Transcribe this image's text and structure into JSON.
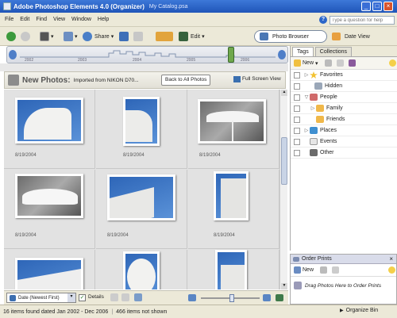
{
  "window": {
    "app_title": "Adobe Photoshop Elements 4.0 (Organizer)",
    "catalog": "My Catalog.psa",
    "minimize": "_",
    "maximize": "□",
    "close": "×"
  },
  "menu": [
    "File",
    "Edit",
    "Find",
    "View",
    "Window",
    "Help"
  ],
  "help_search": {
    "placeholder": "Type a question for help"
  },
  "toolbar": {
    "share_label": "Share",
    "edit_label": "Edit",
    "photo_browser_label": "Photo Browser",
    "date_view_label": "Date View"
  },
  "timeline": {
    "years": [
      "2002",
      "2003",
      "2004",
      "2005",
      "2006"
    ]
  },
  "new_photos": {
    "title": "New Photos:",
    "source": "Imported from NIKON D70...",
    "back_button": "Back to All Photos",
    "full_screen": "Full Screen View"
  },
  "photos": [
    {
      "date": "8/19/2004"
    },
    {
      "date": "8/19/2004"
    },
    {
      "date": "8/19/2004"
    },
    {
      "date": "8/19/2004"
    },
    {
      "date": "8/19/2004"
    },
    {
      "date": "8/19/2004"
    },
    {
      "date": ""
    },
    {
      "date": ""
    },
    {
      "date": ""
    }
  ],
  "bottom": {
    "sort": "Date (Newest First)",
    "details": "Details"
  },
  "status": {
    "text": "16 items found dated Jan 2002 - Dec 2006",
    "hidden": "466 items not shown",
    "organize_bin": "Organize Bin"
  },
  "panel": {
    "tabs": [
      "Tags",
      "Collections"
    ],
    "new_label": "New",
    "tags": [
      {
        "label": "Favorites",
        "level": 0,
        "expander": "▷",
        "icon": "star-icon"
      },
      {
        "label": "Hidden",
        "level": 1,
        "expander": "",
        "icon": "hidden-tag-icon"
      },
      {
        "label": "People",
        "level": 0,
        "expander": "▽",
        "icon": "people-icon"
      },
      {
        "label": "Family",
        "level": 1,
        "expander": "▷",
        "icon": "folder-icon"
      },
      {
        "label": "Friends",
        "level": 1,
        "expander": "",
        "icon": "folder-icon"
      },
      {
        "label": "Places",
        "level": 0,
        "expander": "▷",
        "icon": "globe-icon"
      },
      {
        "label": "Events",
        "level": 0,
        "expander": "",
        "icon": "calendar-icon"
      },
      {
        "label": "Other",
        "level": 0,
        "expander": "",
        "icon": "other-icon"
      }
    ]
  },
  "order_prints": {
    "title": "Order Prints",
    "new_label": "New",
    "hint": "Drag Photos Here to Order Prints"
  },
  "colors": {
    "titlebar": "#2a62c6",
    "chrome": "#ece9d8",
    "accent": "#3d78d8"
  }
}
